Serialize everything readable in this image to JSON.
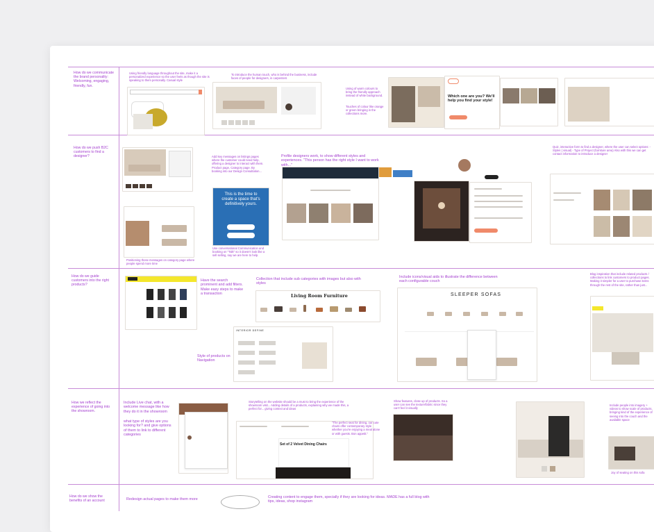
{
  "rows": [
    {
      "question": "How do we communicate the brand personality: Welcoming, engaging, friendly, fun."
    },
    {
      "question": "How do we push B2C customers to find a designer?"
    },
    {
      "question": "How do we guide customers into the right products?"
    },
    {
      "question": "How we reflect the experience of going into the showroom."
    },
    {
      "question": "How do we show the benefits of an account"
    }
  ],
  "notes": {
    "r1_a": "Using friendly language throughout the site, make it a personalized experience so the user feels as though the site is speaking to them personally. Casual style",
    "r1_b": "To introduce the human touch, who is behind the business, include faces of people for designers, in carpenters",
    "r1_c": "Using of warm colours to bring the friendly approach instead of white background.",
    "r1_d": "Touches of colour like orange or green bringing in the collections more.",
    "r1_e": "Which one are you? We'll help you find your style!",
    "r2_a": "Add key messages on listings pages where the customer could need help, offering a designer to interact with them. Product page, Category page. By booking into our Design Consultation...",
    "r2_b": "Profile designers work, to show different styles and experiences. \"This person has the right style I want to work with...\"",
    "r2_c": "Quiz, interactive form to find a designer, where the user can select options: - Styles ( visual) - Type of Project (furniture area) Also with this we can get contact information to introduce a designer",
    "r2_d": "This is the time to create a space that's definitively yours.",
    "r2_e": "Use conversational Communication and booking on \"Talk\" so it doesn't look like a sell selling, say we are here to help.",
    "r2_f": "Positioning those messages on category page where people spend more time",
    "r3_a": "Have the search prominent and add filters. Make easy steps to make a transaction",
    "r3_b": "Collection that include sub categories with images but also with styles",
    "r3_c": "Include icons/visual aids to illustrate the difference between each configurable couch",
    "r3_d": "Blog inspiration that include related products / collections to link customers to product pages. Making it simpler for a user to purchase items through the rest of the site, rather than just...",
    "r3_e": "Style of products on Navigation",
    "r3_heading1": "Living Room Furniture",
    "r3_heading2": "SLEEPER SOFAS",
    "r3_brand": "INTERIOR DEFINE",
    "r4_a": "Include Live chat, with a welcome message like how they do it in the showroom",
    "r4_b": "what type of styles are you looking for? and give options of them to link to different categories",
    "r4_c": "Storytelling on the website should be a must to bring the experience of the showroom visit... Adding details of a products, explaining why we made this, a perfect for... giving context and ideas",
    "r4_d": "Show features, close up of products. So a user can see the texture/fabric since they can't feel it visually",
    "r4_e": "Include people into imagery + videos to show scale of products, bringing kind of the experience of seeing into the couch and the available space",
    "r4_f": "\"The perfect seat for dining, our cute chairs offer contemporary style whether you're enjoying a meal alone or with guests. Bon appetit.\"",
    "r4_g": "Set of 2 Velvet Dining Chairs",
    "r4_h": "Joy of seating on this sofa",
    "r5_a": "Redesign actual pages to make them more",
    "r5_b": "Creating content to engage them, specially if they are looking for ideas. MADE has a full blog with tips, ideas, shop instagram"
  },
  "brand_logo": "MADE",
  "colors": {
    "accent": "#a43fcf",
    "grid": "#c78bd8",
    "blue_card": "#2a6fb5",
    "orange_btn": "#f08a6a"
  }
}
